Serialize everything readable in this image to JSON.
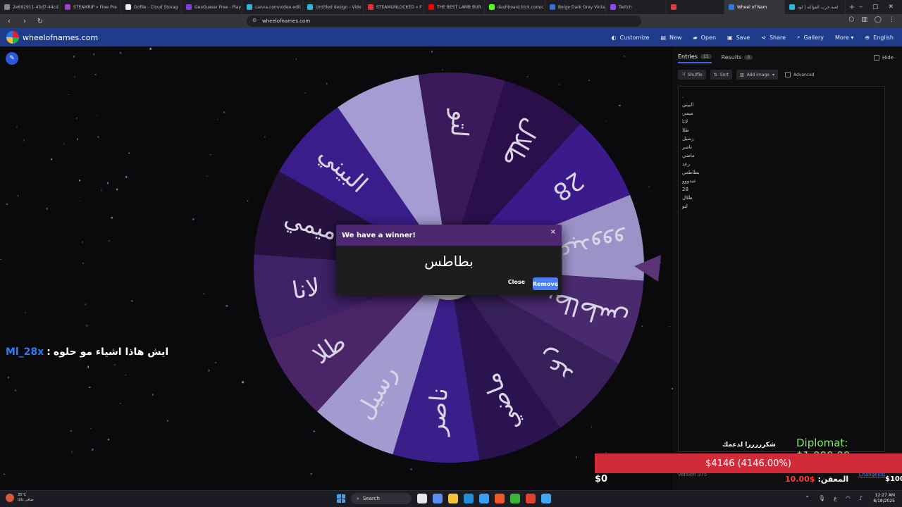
{
  "browser": {
    "tabs": [
      {
        "label": "2e692911-45d7-44cd",
        "color": "#888888",
        "active": false
      },
      {
        "label": "STEAMRIP » Free Pre",
        "color": "#9b3fd6",
        "active": false
      },
      {
        "label": "Gofile - Cloud Storag",
        "color": "#f0f0f0",
        "active": false
      },
      {
        "label": "GeoGuessr Free - Play",
        "color": "#7b3fe4",
        "active": false
      },
      {
        "label": "canva.com/video-edit",
        "color": "#2bb5d8",
        "active": false
      },
      {
        "label": "Untitled design - Vide",
        "color": "#2bb5d8",
        "active": false
      },
      {
        "label": "STEAMUNLOCKED » F",
        "color": "#d33",
        "active": false
      },
      {
        "label": "THE BEST LAMB BUR",
        "color": "#f00",
        "active": false
      },
      {
        "label": "dashboard.kick.com/c",
        "color": "#53fc18",
        "active": false
      },
      {
        "label": "Beige Dark Grey Vinta",
        "color": "#3a6ad8",
        "active": false
      },
      {
        "label": "Twitch",
        "color": "#9146ff",
        "active": false
      },
      {
        "label": "",
        "color": "#d84040",
        "active": false
      },
      {
        "label": "Wheel of Nam",
        "color": "#2a7be0",
        "active": true
      },
      {
        "label": "لعبة حرب الفواكه | لود",
        "color": "#2bb5d8",
        "active": false
      }
    ],
    "url": "wheelofnames.com",
    "new_tab": "+",
    "win_min": "–",
    "win_max": "▢",
    "win_close": "✕"
  },
  "header": {
    "site_title": "wheelofnames.com",
    "menu": [
      {
        "label": "Customize",
        "icon": "palette-icon",
        "glyph": "◐"
      },
      {
        "label": "New",
        "icon": "new-file-icon",
        "glyph": "▤"
      },
      {
        "label": "Open",
        "icon": "folder-icon",
        "glyph": "▰"
      },
      {
        "label": "Save",
        "icon": "save-icon",
        "glyph": "▣"
      },
      {
        "label": "Share",
        "icon": "share-icon",
        "glyph": "⋖"
      },
      {
        "label": "Gallery",
        "icon": "search-icon",
        "glyph": "⌕"
      },
      {
        "label": "More ▾",
        "icon": "more-icon",
        "glyph": ""
      },
      {
        "label": "English",
        "icon": "globe-icon",
        "glyph": "⊕"
      }
    ]
  },
  "wheel": {
    "segments": [
      {
        "label": "لتو",
        "color": "#3a1a5a"
      },
      {
        "label": "طلال",
        "color": "#2a0f4a"
      },
      {
        "label": "28",
        "color": "#3c1a8c"
      },
      {
        "label": "عبدووو",
        "color": "#9b92c8"
      },
      {
        "label": "بطاطس",
        "color": "#4a2a6e"
      },
      {
        "label": "رعد",
        "color": "#37205a"
      },
      {
        "label": "ماضي",
        "color": "#2b1250"
      },
      {
        "label": "ناصر",
        "color": "#3a1e8a"
      },
      {
        "label": "رسيل",
        "color": "#a39ad0"
      },
      {
        "label": "طلا",
        "color": "#4a2568"
      },
      {
        "label": "لانا",
        "color": "#3e2166"
      },
      {
        "label": "ميمي",
        "color": "#26113f"
      },
      {
        "label": "البيني",
        "color": "#3a1d8a"
      },
      {
        "label": "",
        "color": "#a49cd2"
      }
    ],
    "pointer_color": "#5a3474"
  },
  "dialog": {
    "title": "We have a winner!",
    "winner": "بطاطس",
    "close_label": "Close",
    "remove_label": "Remove",
    "close_x": "×"
  },
  "streamer": {
    "name": "Ml_28x",
    "separator": ":",
    "message": "ايش هاذا اشياء مو حلوه"
  },
  "panel": {
    "tab_entries": "Entries",
    "entries_count": "15",
    "tab_results": "Results",
    "results_count": "0",
    "hide_label": "Hide",
    "shuffle_label": "Shuffle",
    "sort_label": "Sort",
    "add_image_label": "Add image",
    "advanced_label": "Advanced",
    "entries": [
      ".",
      "البيني",
      "ميمي",
      "لانا",
      "طلا",
      "رسيل",
      "ناصر",
      "ماضي",
      "رعد",
      "بطاطس",
      "عبدووو",
      "28",
      "طلال",
      "لتو"
    ],
    "version": "Version 375",
    "changelog": "Changelog"
  },
  "overlay": {
    "thanks": "شكرررررا لدعمك",
    "diplomat": "Diplomat: $1,000.00",
    "bar_text": "$4146 (4146.00%)",
    "zero": "$0",
    "mid_value": "10.00$",
    "mid_label": "المعفن:",
    "end_value": "$100"
  },
  "taskbar": {
    "weather_temp": "35°C",
    "weather_desc": "صافي غالبًا",
    "search_label": "Search",
    "time": "12:27 AM",
    "date": "8/18/2025",
    "apps": [
      {
        "name": "files-app",
        "color": "#e8e8e8"
      },
      {
        "name": "copilot-app",
        "color": "#5b8ef0"
      },
      {
        "name": "folder-app",
        "color": "#f5c33b"
      },
      {
        "name": "edge-app",
        "color": "#1e8fd6"
      },
      {
        "name": "store-app",
        "color": "#3aa0f5"
      },
      {
        "name": "brave-app",
        "color": "#f05a2a"
      },
      {
        "name": "xbox-app",
        "color": "#3ab53a"
      },
      {
        "name": "chrome-app",
        "color": "#e04030"
      },
      {
        "name": "notepad-app",
        "color": "#40a8f0"
      }
    ]
  }
}
